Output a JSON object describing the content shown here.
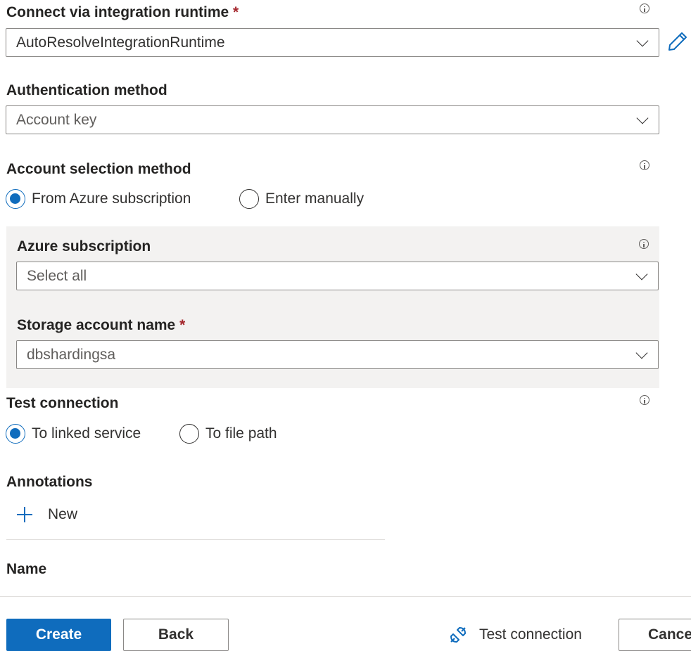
{
  "integration_runtime": {
    "label": "Connect via integration runtime",
    "required_mark": "*",
    "value": "AutoResolveIntegrationRuntime"
  },
  "authentication": {
    "label": "Authentication method",
    "value": "Account key"
  },
  "account_selection": {
    "label": "Account selection method",
    "options": [
      {
        "label": "From Azure subscription",
        "selected": true
      },
      {
        "label": "Enter manually",
        "selected": false
      }
    ]
  },
  "azure_subscription": {
    "label": "Azure subscription",
    "value": "Select all"
  },
  "storage_account": {
    "label": "Storage account name",
    "required_mark": "*",
    "value": "dbshardingsa"
  },
  "test_connection_section": {
    "label": "Test connection",
    "options": [
      {
        "label": "To linked service",
        "selected": true
      },
      {
        "label": "To file path",
        "selected": false
      }
    ]
  },
  "annotations": {
    "label": "Annotations",
    "new_label": "New",
    "column_header": "Name"
  },
  "footer": {
    "create_label": "Create",
    "back_label": "Back",
    "test_connection_label": "Test connection",
    "cancel_label": "Cancel"
  },
  "colors": {
    "accent": "#0f6cbd",
    "required": "#a4262c",
    "panel_background": "#f3f2f1"
  }
}
